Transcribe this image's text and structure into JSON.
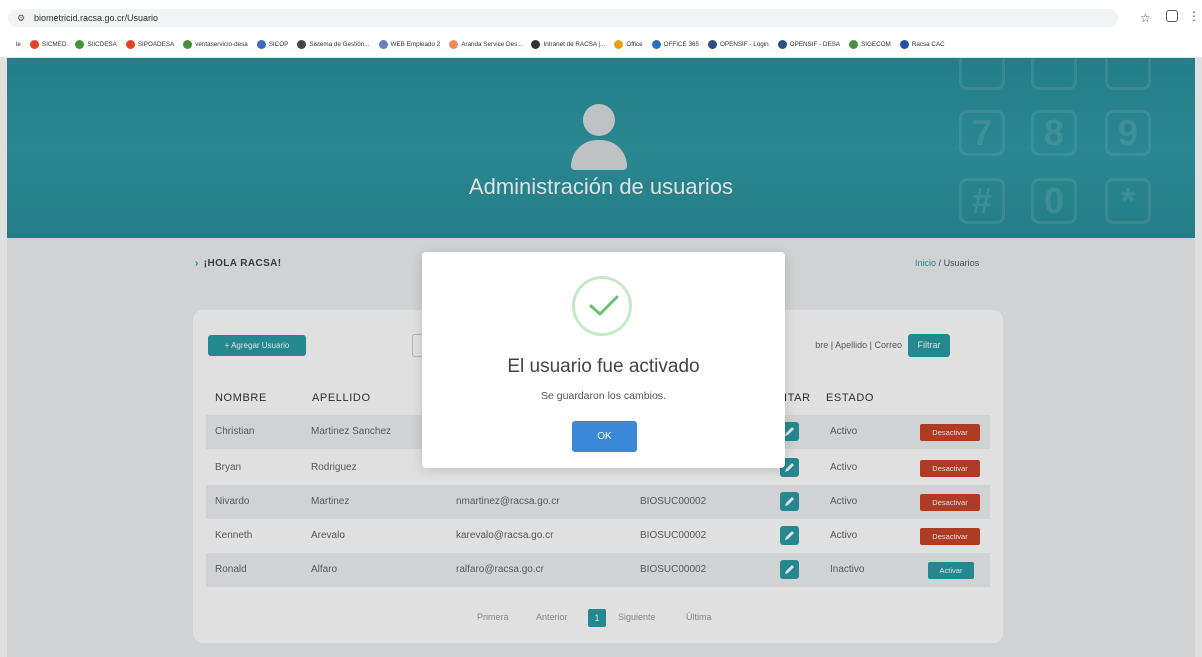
{
  "browser": {
    "url": "biometricid.racsa.go.cr/Usuario",
    "bookmarks": [
      {
        "label": "le",
        "color": "#ffffff"
      },
      {
        "label": "SICMED",
        "color": "#e0452a"
      },
      {
        "label": "SIICDESA",
        "color": "#4a8f3e"
      },
      {
        "label": "SIPOADESA",
        "color": "#e0452a"
      },
      {
        "label": "ventaservicio-desa",
        "color": "#4a8f3e"
      },
      {
        "label": "SICOP",
        "color": "#3a6bbf"
      },
      {
        "label": "Sistema de Gestión...",
        "color": "#444444"
      },
      {
        "label": "WEB Empleado 2",
        "color": "#6b7cc0"
      },
      {
        "label": "Aranda Service Des...",
        "color": "#f08a5d"
      },
      {
        "label": "Intranet de RACSA |...",
        "color": "#333333"
      },
      {
        "label": "Office",
        "color": "#e6a117"
      },
      {
        "label": "OFFICE 365",
        "color": "#2b6fbf"
      },
      {
        "label": "OPENSIF - Login",
        "color": "#2b4f7f"
      },
      {
        "label": "OPENSIF - DESA",
        "color": "#2b4f7f"
      },
      {
        "label": "SIGECOM",
        "color": "#4a8f3e"
      },
      {
        "label": "Racsa CAC",
        "color": "#2b4fa0"
      }
    ]
  },
  "hero": {
    "title": "Administración de usuarios"
  },
  "greeting": "¡HOLA RACSA!",
  "breadcrumb": {
    "home": "Inicio",
    "separator": "/",
    "current": "Usuarios"
  },
  "toolbar": {
    "add_label": "+ Agregar Usuario",
    "search_placeholder": "bre | Apellido | Correo",
    "filter_label": "Filtrar"
  },
  "table": {
    "headers": {
      "nombre": "NOMBRE",
      "apellido": "APELLIDO",
      "editar": "ITAR",
      "estado": "ESTADO"
    },
    "rows": [
      {
        "nombre": "Christian",
        "apellido": "Martinez Sanchez",
        "correo": "",
        "codigo": "",
        "estado": "Activo",
        "accion": "Desactivar"
      },
      {
        "nombre": "Bryan",
        "apellido": "Rodriguez",
        "correo": "",
        "codigo": "",
        "estado": "Activo",
        "accion": "Desactivar"
      },
      {
        "nombre": "Nivardo",
        "apellido": "Martinez",
        "correo": "nmartinez@racsa.go.cr",
        "codigo": "BIOSUC00002",
        "estado": "Activo",
        "accion": "Desactivar"
      },
      {
        "nombre": "Kenneth",
        "apellido": "Arevalo",
        "correo": "karevalo@racsa.go.cr",
        "codigo": "BIOSUC00002",
        "estado": "Activo",
        "accion": "Desactivar"
      },
      {
        "nombre": "Ronald",
        "apellido": "Alfaro",
        "correo": "ralfaro@racsa.go.cr",
        "codigo": "BIOSUC00002",
        "estado": "Inactivo",
        "accion": "Activar"
      }
    ]
  },
  "pagination": {
    "first": "Primera",
    "prev": "Anterior",
    "current": "1",
    "next": "Siguiente",
    "last": "Última"
  },
  "modal": {
    "title": "El usuario fue activado",
    "message": "Se guardaron los cambios.",
    "ok_label": "OK"
  },
  "colors": {
    "accent": "#2b9aa4",
    "danger": "#c9442a",
    "ok_button": "#3b88d8",
    "success": "#6cc070"
  }
}
